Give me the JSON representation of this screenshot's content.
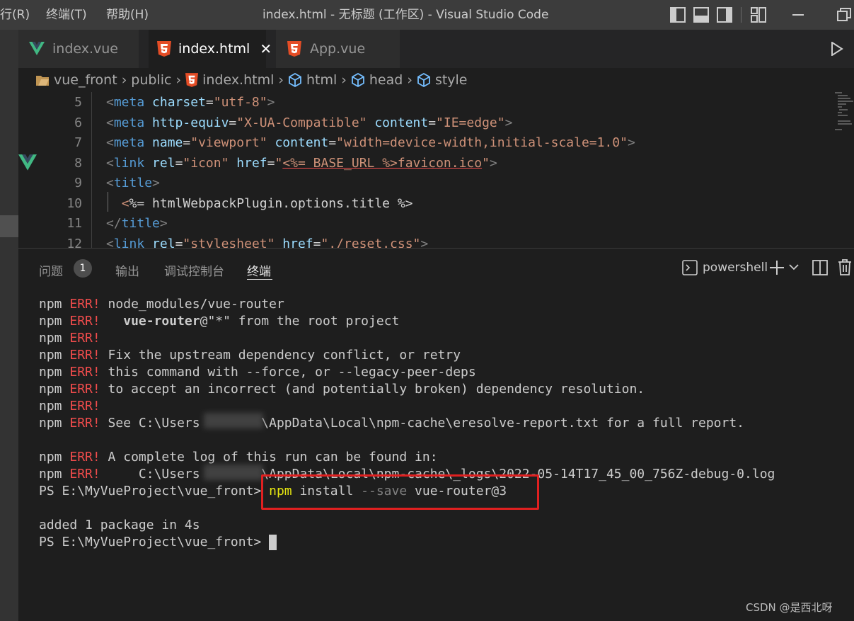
{
  "titlebar": {
    "menu": [
      "行(R)",
      "终端(T)",
      "帮助(H)"
    ],
    "title": "index.html - 无标题 (工作区) - Visual Studio Code"
  },
  "tabs": [
    {
      "label": "index.vue",
      "icon": "vue-icon",
      "active": false
    },
    {
      "label": "index.html",
      "icon": "html5-icon",
      "active": true
    },
    {
      "label": "App.vue",
      "icon": "html5-icon",
      "active": false
    }
  ],
  "breadcrumb": [
    "vue_front",
    "public",
    "index.html",
    "html",
    "head",
    "style"
  ],
  "editor": {
    "line_numbers": [
      "5",
      "6",
      "7",
      "8",
      "9",
      "10",
      "11",
      "12"
    ],
    "lines": [
      [
        [
          "t-punct",
          "<"
        ],
        [
          "t-tag",
          "meta"
        ],
        [
          "t-plain",
          " "
        ],
        [
          "t-attr",
          "charset"
        ],
        [
          "t-plain",
          "="
        ],
        [
          "t-str",
          "\"utf-8\""
        ],
        [
          "t-punct",
          ">"
        ]
      ],
      [
        [
          "t-punct",
          "<"
        ],
        [
          "t-tag",
          "meta"
        ],
        [
          "t-plain",
          " "
        ],
        [
          "t-attr",
          "http-equiv"
        ],
        [
          "t-plain",
          "="
        ],
        [
          "t-str",
          "\"X-UA-Compatible\""
        ],
        [
          "t-plain",
          " "
        ],
        [
          "t-attr",
          "content"
        ],
        [
          "t-plain",
          "="
        ],
        [
          "t-str",
          "\"IE=edge\""
        ],
        [
          "t-punct",
          ">"
        ]
      ],
      [
        [
          "t-punct",
          "<"
        ],
        [
          "t-tag",
          "meta"
        ],
        [
          "t-plain",
          " "
        ],
        [
          "t-attr",
          "name"
        ],
        [
          "t-plain",
          "="
        ],
        [
          "t-str",
          "\"viewport\""
        ],
        [
          "t-plain",
          " "
        ],
        [
          "t-attr",
          "content"
        ],
        [
          "t-plain",
          "="
        ],
        [
          "t-str",
          "\"width=device-width,initial-scale=1.0\""
        ],
        [
          "t-punct",
          ">"
        ]
      ],
      [
        [
          "t-punct",
          "<"
        ],
        [
          "t-tag",
          "link"
        ],
        [
          "t-plain",
          " "
        ],
        [
          "t-attr",
          "rel"
        ],
        [
          "t-plain",
          "="
        ],
        [
          "t-str",
          "\"icon\""
        ],
        [
          "t-plain",
          " "
        ],
        [
          "t-attr",
          "href"
        ],
        [
          "t-plain",
          "="
        ],
        [
          "t-str",
          "\""
        ],
        [
          "t-str squiggle",
          "<%= BASE_URL %>favicon.ico"
        ],
        [
          "t-str",
          "\""
        ],
        [
          "t-punct",
          ">"
        ]
      ],
      [
        [
          "t-punct",
          "<"
        ],
        [
          "t-tag",
          "title"
        ],
        [
          "t-punct",
          ">"
        ]
      ],
      [
        [
          "t-plain",
          "  "
        ],
        [
          "t-str",
          "<"
        ],
        [
          "t-plain",
          "%= htmlWebpackPlugin.options.title %>"
        ]
      ],
      [
        [
          "t-punct",
          "</"
        ],
        [
          "t-tag",
          "title"
        ],
        [
          "t-punct",
          ">"
        ]
      ],
      [
        [
          "t-punct",
          "<"
        ],
        [
          "t-tag",
          "link"
        ],
        [
          "t-plain",
          " "
        ],
        [
          "t-attr",
          "rel"
        ],
        [
          "t-plain",
          "="
        ],
        [
          "t-str",
          "\"stylesheet\""
        ],
        [
          "t-plain",
          " "
        ],
        [
          "t-attr",
          "href"
        ],
        [
          "t-plain",
          "="
        ],
        [
          "t-str",
          "\"./reset.css\""
        ],
        [
          "t-punct",
          ">"
        ]
      ]
    ]
  },
  "panel": {
    "tabs": [
      "问题",
      "输出",
      "调试控制台",
      "终端"
    ],
    "problems_count": "1",
    "active_tab": "终端",
    "shell_label": "powershell"
  },
  "terminal": {
    "lines": [
      [
        [
          "",
          "npm "
        ],
        [
          "err",
          "ERR!"
        ],
        [
          "",
          " node_modules/vue-router"
        ]
      ],
      [
        [
          "",
          "npm "
        ],
        [
          "err",
          "ERR!"
        ],
        [
          "",
          "   "
        ],
        [
          "bold",
          "vue-router"
        ],
        [
          "",
          "@\"*\" from the root project"
        ]
      ],
      [
        [
          "",
          "npm "
        ],
        [
          "err",
          "ERR!"
        ]
      ],
      [
        [
          "",
          "npm "
        ],
        [
          "err",
          "ERR!"
        ],
        [
          "",
          " Fix the upstream dependency conflict, or retry"
        ]
      ],
      [
        [
          "",
          "npm "
        ],
        [
          "err",
          "ERR!"
        ],
        [
          "",
          " this command with --force, or --legacy-peer-deps"
        ]
      ],
      [
        [
          "",
          "npm "
        ],
        [
          "err",
          "ERR!"
        ],
        [
          "",
          " to accept an incorrect (and potentially broken) dependency resolution."
        ]
      ],
      [
        [
          "",
          "npm "
        ],
        [
          "err",
          "ERR!"
        ]
      ],
      [
        [
          "",
          "npm "
        ],
        [
          "err",
          "ERR!"
        ],
        [
          "",
          " See C:\\Users        \\AppData\\Local\\npm-cache\\eresolve-report.txt for a full report."
        ]
      ],
      [
        [
          "",
          ""
        ]
      ],
      [
        [
          "",
          "npm "
        ],
        [
          "err",
          "ERR!"
        ],
        [
          "",
          " A complete log of this run can be found in:"
        ]
      ],
      [
        [
          "",
          "npm "
        ],
        [
          "err",
          "ERR!"
        ],
        [
          "",
          "     C:\\Users        \\AppData\\Local\\npm-cache\\_logs\\2022-05-14T17_45_00_756Z-debug-0.log"
        ]
      ],
      [
        [
          "",
          "PS E:\\MyVueProject\\vue_front> "
        ],
        [
          "npm-cmd",
          "npm"
        ],
        [
          "",
          " install "
        ],
        [
          "flag",
          "--save"
        ],
        [
          "",
          " vue-router@3"
        ]
      ],
      [
        [
          "",
          ""
        ]
      ],
      [
        [
          "",
          "added 1 package in 4s"
        ]
      ],
      [
        [
          "",
          "PS E:\\MyVueProject\\vue_front> "
        ]
      ]
    ]
  },
  "watermark": "CSDN @是西北呀"
}
